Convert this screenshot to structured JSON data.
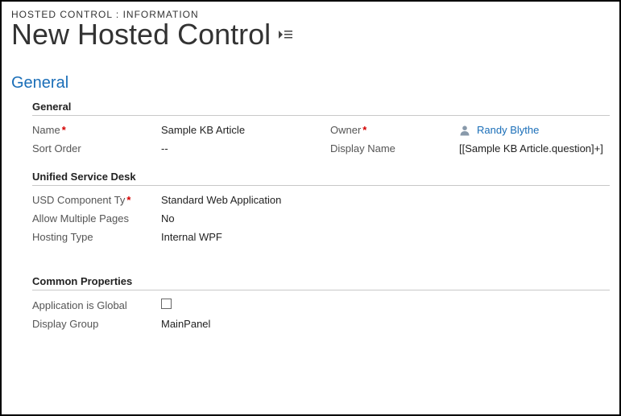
{
  "header": {
    "breadcrumb": "HOSTED CONTROL : INFORMATION",
    "title": "New Hosted Control"
  },
  "tabs": {
    "general": "General"
  },
  "sections": {
    "general": {
      "title": "General",
      "fields": {
        "name": {
          "label": "Name",
          "value": "Sample KB Article",
          "required": true
        },
        "owner": {
          "label": "Owner",
          "value": "Randy Blythe",
          "required": true
        },
        "sort_order": {
          "label": "Sort Order",
          "value": "--"
        },
        "display_name": {
          "label": "Display Name",
          "value": "[[Sample KB Article.question]+]"
        }
      }
    },
    "usd": {
      "title": "Unified Service Desk",
      "fields": {
        "component_type": {
          "label": "USD Component Ty",
          "value": "Standard Web Application",
          "required": true
        },
        "allow_multiple": {
          "label": "Allow Multiple Pages",
          "value": "No"
        },
        "hosting_type": {
          "label": "Hosting Type",
          "value": "Internal WPF"
        }
      }
    },
    "common": {
      "title": "Common Properties",
      "fields": {
        "app_global": {
          "label": "Application is Global",
          "checked": false
        },
        "display_group": {
          "label": "Display Group",
          "value": "MainPanel"
        }
      }
    }
  }
}
